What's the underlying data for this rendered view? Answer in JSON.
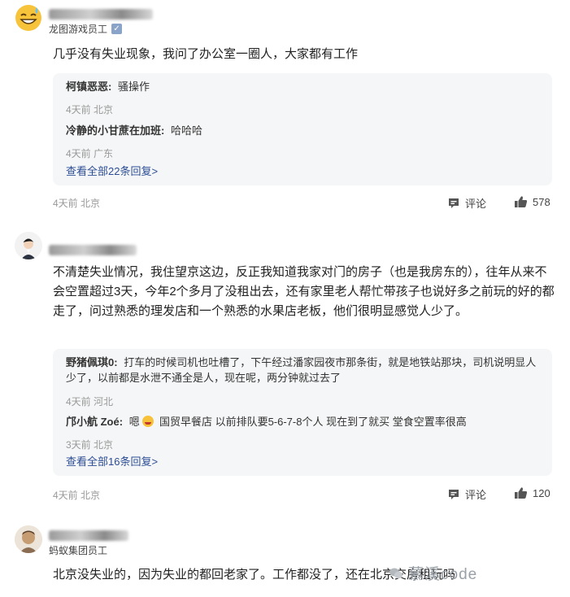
{
  "comments": [
    {
      "title": "龙图游戏员工",
      "text": "几乎没有失业现象，我问了办公室一圈人，大家都有工作",
      "replies": [
        {
          "author": "柯镇恶恶:",
          "text": "骚操作",
          "meta": "4天前 北京"
        },
        {
          "author": "冷静的小甘蔗在加班:",
          "text": "哈哈哈",
          "meta": "4天前 广东"
        }
      ],
      "view_all": "查看全部22条回复>",
      "meta": "4天前 北京",
      "comment_label": "评论",
      "likes": "578"
    },
    {
      "text": "不清楚失业情况，我住望京这边，反正我知道我家对门的房子（也是我房东的），往年从来不会空置超过3天，今年2个多月了没租出去，还有家里老人帮忙带孩子也说好多之前玩的好的都走了，问过熟悉的理发店和一个熟悉的水果店老板，他们很明显感觉人少了。",
      "replies": [
        {
          "author": "野猪佩琪0:",
          "text": "打车的时候司机也吐槽了，下午经过潘家园夜市那条街，就是地铁站那块，司机说明显人少了，以前都是水泄不通全是人，现在呢，两分钟就过去了",
          "meta": "4天前 河北"
        },
        {
          "author": "邝小航 Zoé:",
          "text_pre": "嗯",
          "text": "国贸早餐店 以前排队要5-6-7-8个人 现在到了就买 堂食空置率很高",
          "meta": "3天前 北京"
        }
      ],
      "view_all": "查看全部16条回复>",
      "meta": "4天前 北京",
      "comment_label": "评论",
      "likes": "120"
    },
    {
      "title": "蚂蚁集团员工",
      "text": "北京没失业的，因为失业的都回老家了。工作都没了，还在北京交房租玩吗"
    }
  ],
  "watermark": "慕溪code",
  "icons": {
    "comment": "comment-icon",
    "like": "thumbs-up-icon",
    "verified": "verified-badge-icon"
  }
}
